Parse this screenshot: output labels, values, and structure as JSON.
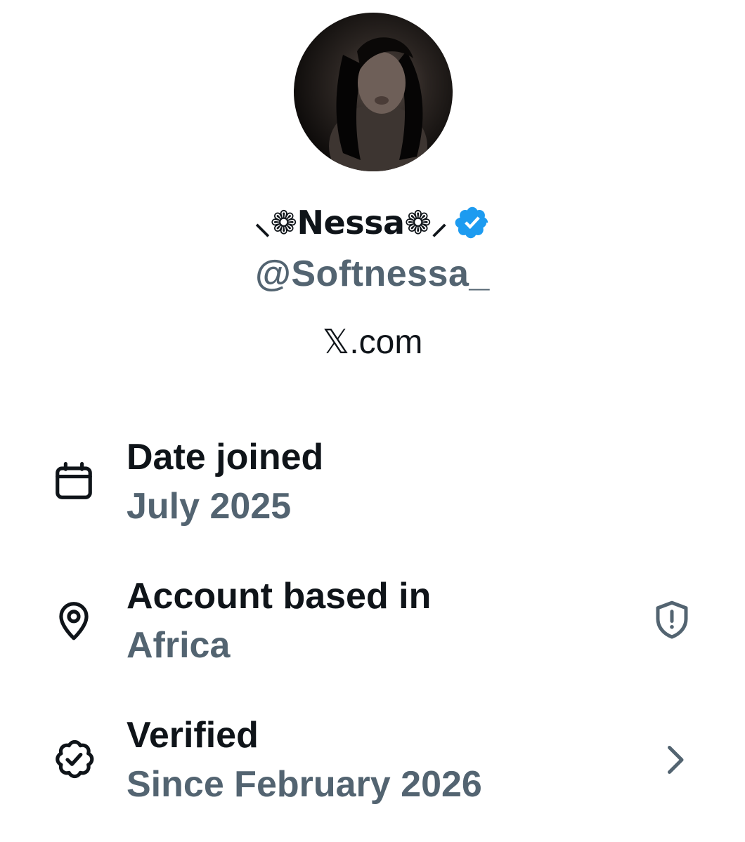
{
  "profile": {
    "display_name": "⸜❁Nessa❁⸝",
    "handle": "@Softnessa_",
    "site": "𝕏.com",
    "avatar_icon": "profile-photo",
    "verified_icon": "verified-badge-icon",
    "colors": {
      "verified_blue": "#1d9bf0",
      "secondary_text": "#536471",
      "primary_text": "#0f1419"
    }
  },
  "details": [
    {
      "icon": "calendar-icon",
      "title": "Date joined",
      "value": "July 2025"
    },
    {
      "icon": "location-pin-icon",
      "title": "Account based in",
      "value": "Africa",
      "trailing_icon": "shield-alert-icon"
    },
    {
      "icon": "verified-outline-icon",
      "title": "Verified",
      "value": "Since February 2026",
      "trailing_icon": "chevron-right-icon"
    }
  ]
}
